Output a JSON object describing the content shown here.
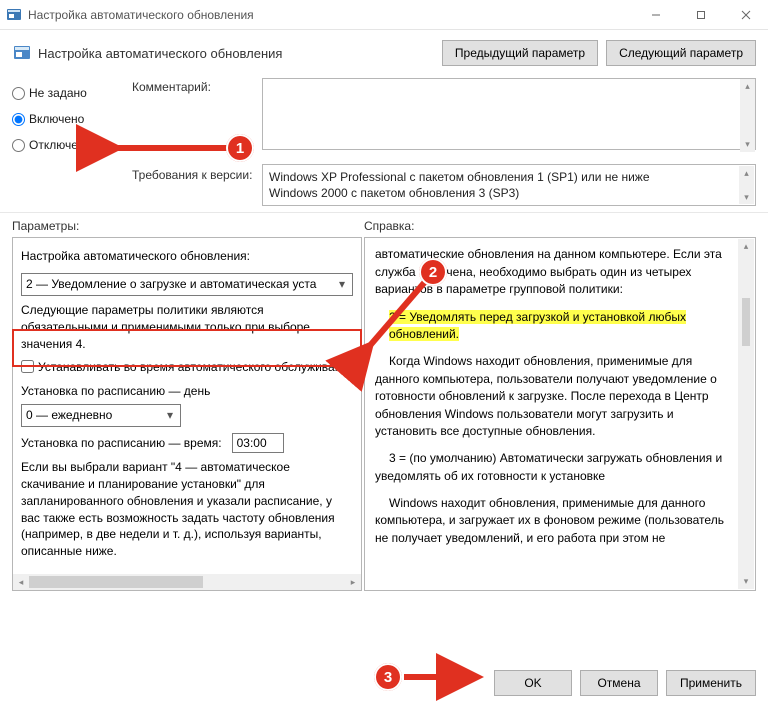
{
  "window": {
    "title": "Настройка автоматического обновления"
  },
  "header": {
    "title": "Настройка автоматического обновления",
    "prev_btn": "Предыдущий параметр",
    "next_btn": "Следующий параметр"
  },
  "state_radios": {
    "not_configured": "Не задано",
    "enabled": "Включено",
    "disabled": "Отключено",
    "selected": "enabled"
  },
  "comment": {
    "label": "Комментарий:",
    "value": ""
  },
  "requirements": {
    "label": "Требования к версии:",
    "line1": "Windows XP Professional с пакетом обновления 1 (SP1) или не ниже",
    "line2": "Windows 2000 с пакетом обновления 3 (SP3)"
  },
  "section_labels": {
    "options": "Параметры:",
    "help": "Справка:"
  },
  "options": {
    "config_label": "Настройка автоматического обновления:",
    "config_value": "2 — Уведомление о загрузке и автоматическая уста",
    "note": "Следующие параметры политики являются обязательными и применимыми только при выборе значения 4.",
    "checkbox_label": "Устанавливать во время автоматического обслуживания",
    "checkbox_checked": false,
    "day_label": "Установка по расписанию — день",
    "day_value": "0 — ежедневно",
    "time_label": "Установка по расписанию — время:",
    "time_value": "03:00",
    "paragraph": "Если вы выбрали вариант \"4 — автоматическое скачивание и планирование установки\" для запланированного обновления и указали расписание, у вас также есть возможность задать частоту обновления (например, в две недели и т. д.), используя варианты, описанные ниже."
  },
  "help": {
    "p1": "автоматические обновления на данном компьютере. Если эта служба включена, необходимо выбрать один из четырех вариантов в параметре групповой политики:",
    "hl": "2 = Уведомлять перед загрузкой и установкой любых обновлений.",
    "p2": "Когда Windows находит обновления, применимые для данного компьютера, пользователи получают уведомление о готовности обновлений к загрузке. После перехода в Центр обновления Windows пользователи могут загрузить и установить все доступные обновления.",
    "p3": "3 = (по умолчанию) Автоматически загружать обновления и уведомлять об их готовности к установке",
    "p4": "Windows находит обновления, применимые для данного компьютера, и загружает их в фоновом режиме (пользователь не получает уведомлений, и его работа при этом не"
  },
  "buttons": {
    "ok": "OK",
    "cancel": "Отмена",
    "apply": "Применить"
  },
  "annotations": {
    "b1": "1",
    "b2": "2",
    "b3": "3"
  }
}
